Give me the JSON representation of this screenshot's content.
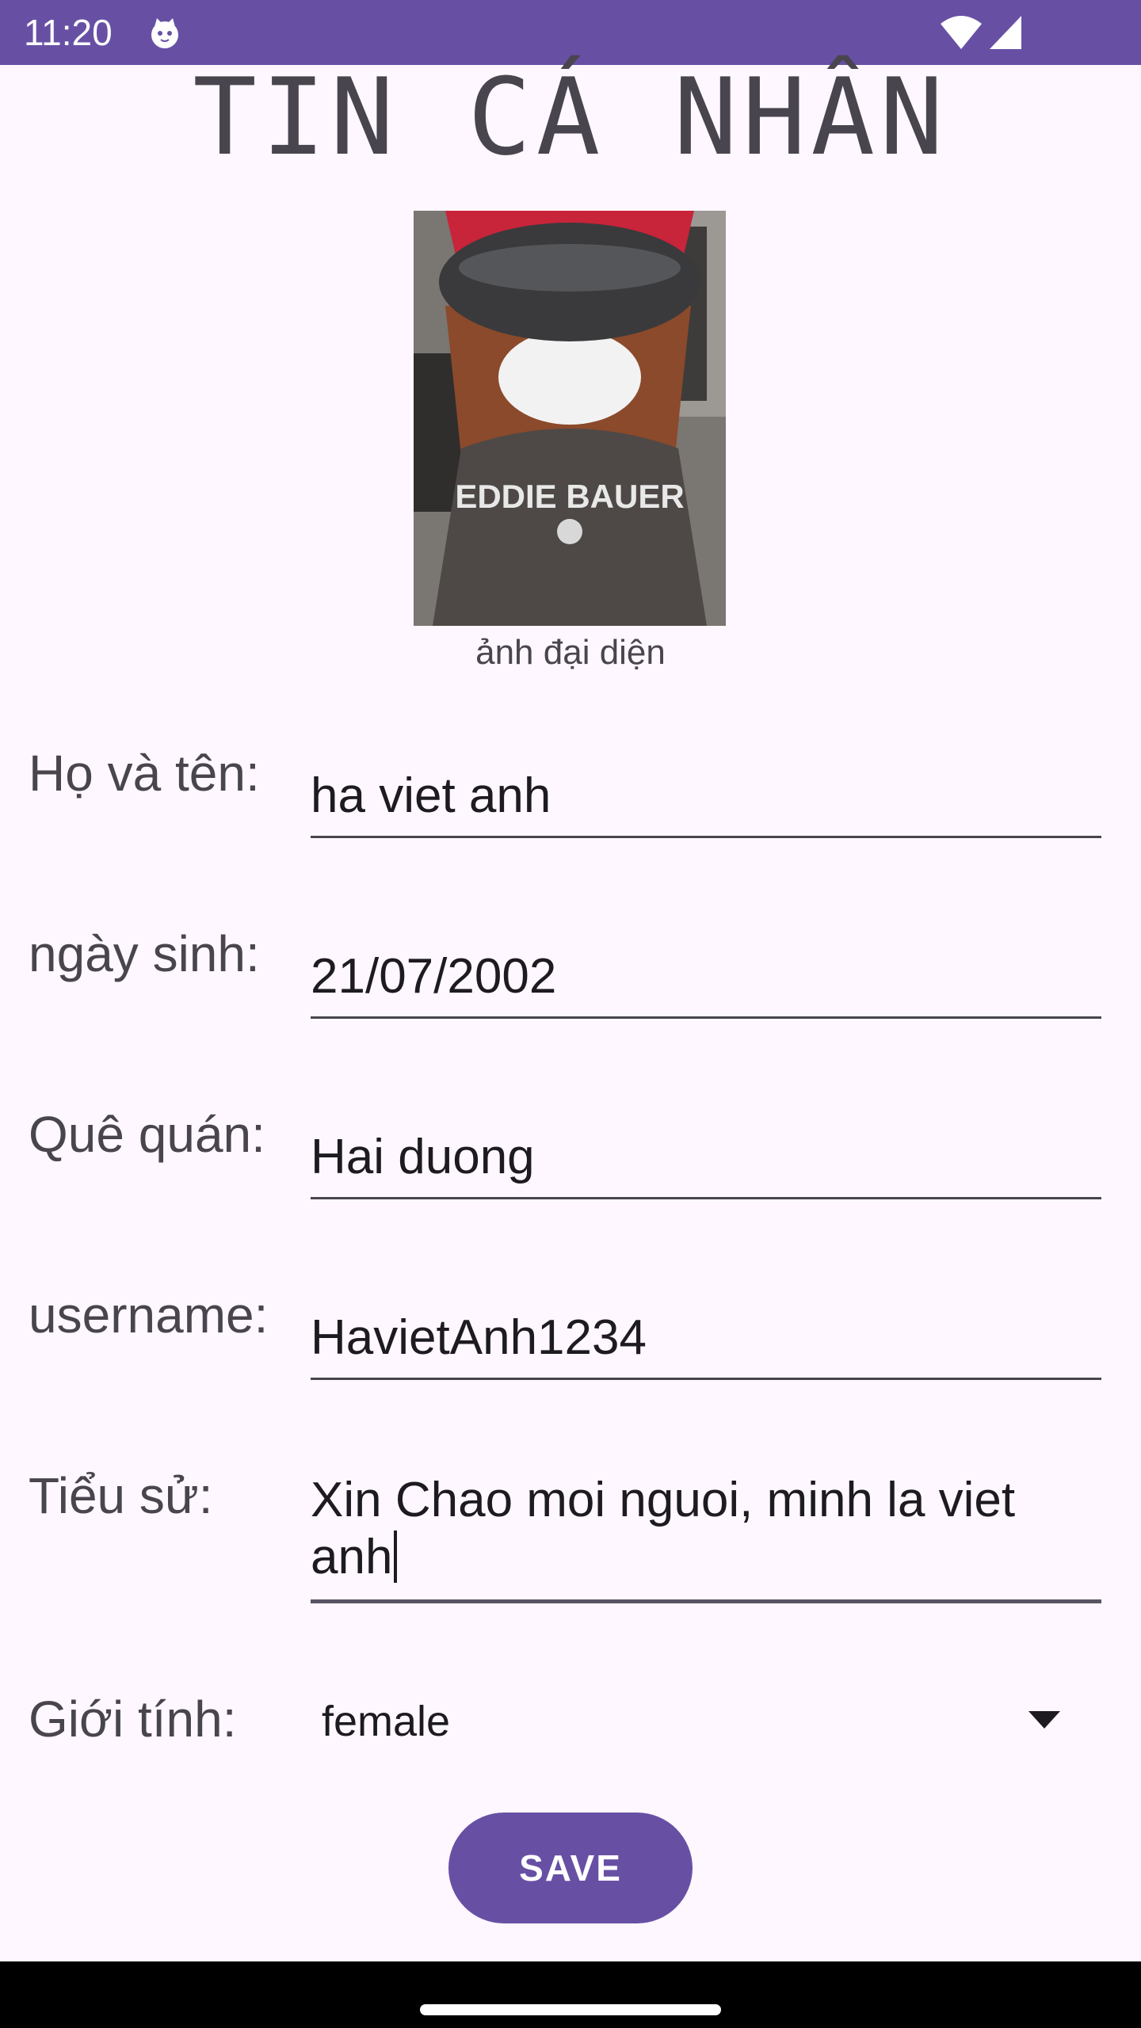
{
  "status_bar": {
    "time": "11:20",
    "icons": [
      "cat-notification-icon",
      "wifi-icon",
      "signal-icon"
    ],
    "background": "#6750A4"
  },
  "page": {
    "title": "TIN CÁ NHÂN",
    "avatar_caption": "ảnh đại diện"
  },
  "form": {
    "fullname_label": "Họ và tên:",
    "fullname_value": "ha viet anh",
    "birthday_label": "ngày sinh:",
    "birthday_value": "21/07/2002",
    "hometown_label": "Quê quán:",
    "hometown_value": "Hai duong",
    "username_label": "username:",
    "username_value": "HavietAnh1234",
    "bio_label": "Tiểu sử:",
    "bio_value": "Xin Chao moi nguoi, minh la viet anh",
    "gender_label": "Giới tính:",
    "gender_value": "female"
  },
  "actions": {
    "save_label": "SAVE"
  },
  "colors": {
    "primary": "#6750A4",
    "background": "#FEF7FF",
    "label_text": "#49454F"
  }
}
